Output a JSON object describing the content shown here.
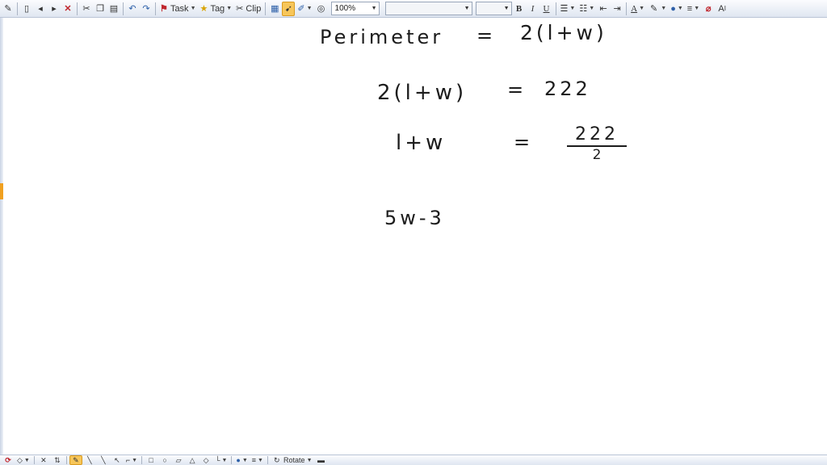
{
  "toolbar": {
    "task_label": "Task",
    "tag_label": "Tag",
    "clip_label": "Clip",
    "zoom_value": "100%",
    "font_value": "",
    "size_value": "",
    "bold_label": "B",
    "italic_label": "I",
    "underline_label": "U",
    "text_color_label": "A",
    "font_size_label": "A",
    "font_size_suffix": "I",
    "icons": [
      "pen-icon",
      "new-page-icon",
      "back-icon",
      "forward-icon",
      "delete-icon",
      "cut-icon",
      "copy-icon",
      "paste-icon",
      "undo-icon",
      "redo-icon",
      "flag-icon",
      "star-icon",
      "clip-icon",
      "table-icon",
      "pointer-icon",
      "pen-tool-icon",
      "target-icon",
      "bullets-icon",
      "numbering-icon",
      "outdent-icon",
      "indent-icon",
      "highlighter-icon",
      "fill-color-icon",
      "line-style-icon",
      "eraser-icon"
    ],
    "highlight_color": "#f7c65a"
  },
  "bottom_toolbar": {
    "rotate_label": "Rotate",
    "icons": [
      "lasso-icon",
      "eraser-icon",
      "delete-icon",
      "flip-icon",
      "pen-icon",
      "line-icon",
      "line-icon-2",
      "arrow-icon",
      "connector-icon",
      "rectangle-icon",
      "ellipse-icon",
      "parallelogram-icon",
      "triangle-icon",
      "diamond-icon",
      "elbow-icon",
      "color-icon",
      "line-weight-icon",
      "rotate-icon"
    ]
  },
  "canvas": {
    "line1_left": "Perimeter",
    "line1_eq": "=",
    "line1_right": "2(l+w)",
    "line2_left": "2(l+w)",
    "line2_eq": "=",
    "line2_right": "222",
    "line3_left": "l+w",
    "line3_eq": "=",
    "line3_num": "222",
    "line3_den": "2",
    "line4": "5w-3"
  }
}
